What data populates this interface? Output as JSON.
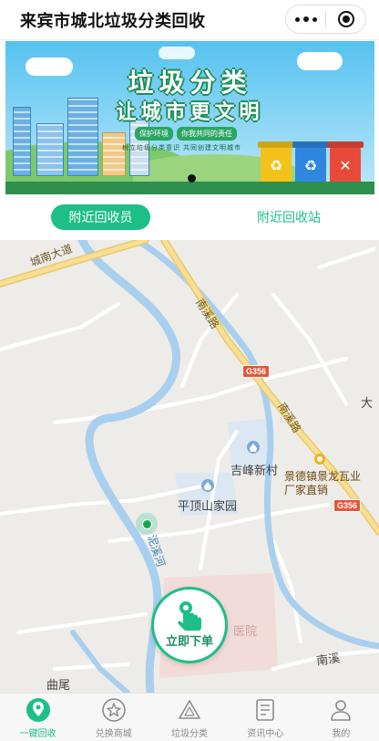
{
  "header": {
    "title": "来宾市城北垃圾分类回收"
  },
  "banner": {
    "headline": "垃圾分类",
    "subline": "让城市更文明",
    "slogans": [
      "保护环境",
      "你我共同的责任"
    ],
    "tiny_text": "树立垃圾分类意识  共同创建文明城市",
    "bin_symbols": [
      "♻",
      "♻",
      "✕"
    ],
    "colors": {
      "bin1": "#f2c21b",
      "bin2": "#2e86de",
      "bin3": "#e84a3a"
    }
  },
  "segments": {
    "active": "附近回收员",
    "inactive": "附近回收站"
  },
  "map": {
    "labels": {
      "chengnan_road": "城南大道",
      "nanxi_road_1": "南溪路",
      "nanxi_road_2": "南溪路",
      "highway_shield_1": "G356",
      "highway_shield_2": "G356",
      "jifeng_village": "吉峰新村",
      "pingdingshan": "平顶山家园",
      "jingdezhen_poi": "景德镇景龙瓦业厂家直销",
      "river": "泥溪河",
      "hospital": "医院",
      "nanxi_bottom": "南溪",
      "qu_wei": "曲尾",
      "da_edge": "大"
    }
  },
  "fab": {
    "label": "立即下单"
  },
  "tabs": [
    {
      "label": "一键回收",
      "icon": "recycle-pin-icon"
    },
    {
      "label": "兑换商城",
      "icon": "star-icon"
    },
    {
      "label": "垃圾分类",
      "icon": "triangle-icon"
    },
    {
      "label": "资讯中心",
      "icon": "newspaper-icon"
    },
    {
      "label": "我的",
      "icon": "user-icon"
    }
  ],
  "colors": {
    "accent": "#1dbf87",
    "shield": "#e4573a"
  }
}
